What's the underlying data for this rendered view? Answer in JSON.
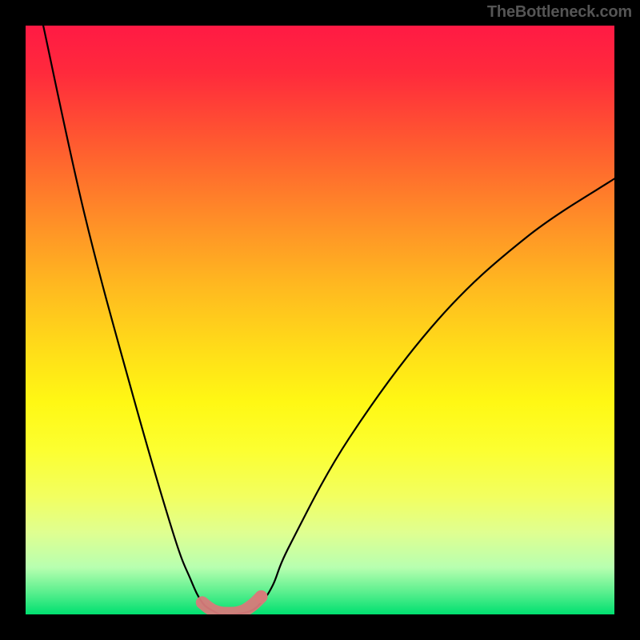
{
  "watermark": "TheBottleneck.com",
  "chart_data": {
    "type": "line",
    "title": "",
    "xlabel": "",
    "ylabel": "",
    "xlim": [
      0,
      100
    ],
    "ylim": [
      0,
      100
    ],
    "series": [
      {
        "name": "bottleneck-curve",
        "x": [
          3,
          10,
          18,
          25,
          28,
          30,
          32,
          33,
          34,
          35,
          38,
          40,
          42,
          45,
          55,
          70,
          85,
          100
        ],
        "y": [
          100,
          68,
          38,
          14,
          6,
          2,
          0.5,
          0,
          0,
          0,
          0.5,
          2,
          5,
          12,
          30,
          50,
          64,
          74
        ]
      },
      {
        "name": "highlight-segment",
        "x": [
          30,
          31,
          32,
          33,
          34,
          35,
          36,
          37,
          38,
          39,
          40
        ],
        "y": [
          2,
          1.2,
          0.6,
          0.3,
          0.2,
          0.2,
          0.3,
          0.6,
          1.2,
          2,
          3
        ]
      }
    ],
    "annotations": []
  },
  "colors": {
    "curve": "#000000",
    "highlight": "#d77a7a",
    "background_top": "#ff1a44",
    "background_bottom": "#00e070",
    "frame": "#000000"
  }
}
